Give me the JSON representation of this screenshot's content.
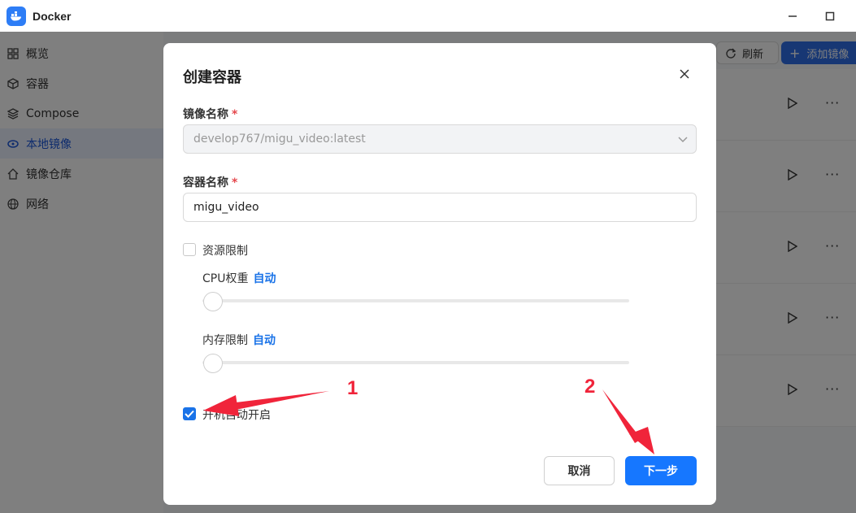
{
  "window": {
    "title": "Docker",
    "minimize_icon": "minimize-icon",
    "maximize_icon": "maximize-icon"
  },
  "sidebar": {
    "items": [
      {
        "label": "概览",
        "icon": "grid-icon",
        "active": false
      },
      {
        "label": "容器",
        "icon": "cube-icon",
        "active": false
      },
      {
        "label": "Compose",
        "icon": "layers-icon",
        "active": false
      },
      {
        "label": "本地镜像",
        "icon": "disk-icon",
        "active": true
      },
      {
        "label": "镜像仓库",
        "icon": "home-icon",
        "active": false
      },
      {
        "label": "网络",
        "icon": "globe-icon",
        "active": false
      }
    ]
  },
  "toolbar": {
    "refresh_label": "刷新",
    "add_label": "添加镜像"
  },
  "dialog": {
    "title": "创建容器",
    "image_label": "镜像名称",
    "image_value": "develop767/migu_video:latest",
    "container_label": "容器名称",
    "container_value": "migu_video",
    "required_mark": "*",
    "resource_limit_label": "资源限制",
    "resource_limit_checked": false,
    "cpu_label": "CPU权重",
    "cpu_value": "自动",
    "memory_label": "内存限制",
    "memory_value": "自动",
    "autostart_label": "开机自动开启",
    "autostart_checked": true,
    "cancel_label": "取消",
    "next_label": "下一步"
  },
  "annotations": {
    "marker_1": "1",
    "marker_2": "2",
    "color": "#f0243a"
  },
  "colors": {
    "accent": "#1677ff",
    "sidebar_active_bg": "#eaf1ff"
  }
}
